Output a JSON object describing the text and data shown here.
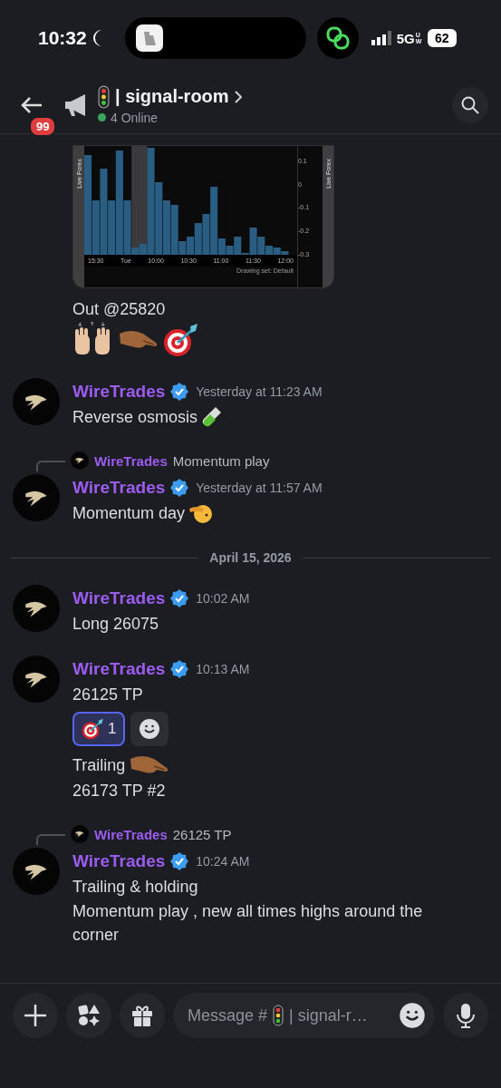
{
  "status_bar": {
    "time": "10:32",
    "network": "5G",
    "network_sub": "UW",
    "battery": "62"
  },
  "header": {
    "unread_badge": "99",
    "channel": "| signal-room",
    "online": "4 Online"
  },
  "attachment": {
    "side_labels": [
      "Live Forex",
      "Live Forex"
    ],
    "y_labels": [
      "0.1",
      "0",
      "-0.1",
      "-0.2",
      "-0.3"
    ],
    "x_labels": [
      "15:30",
      "Tue",
      "10:00",
      "10:30",
      "11:00",
      "11:30",
      "12:00"
    ],
    "footer": "Drawing set: Default"
  },
  "messages": [
    {
      "kind": "continued",
      "lines": [
        {
          "text": "Out @25820"
        },
        {
          "emoji": [
            {
              "kind": "hands"
            },
            {
              "kind": "reach"
            },
            {
              "kind": "target"
            }
          ]
        }
      ]
    },
    {
      "kind": "full",
      "author": "WireTrades",
      "verified": true,
      "time": "Yesterday at 11:23 AM",
      "lines": [
        {
          "text": "Reverse osmosis",
          "emoji": [
            {
              "kind": "tube"
            }
          ]
        }
      ]
    },
    {
      "kind": "full",
      "reply": {
        "author": "WireTrades",
        "text": "Momentum play"
      },
      "author": "WireTrades",
      "verified": true,
      "time": "Yesterday at 11:57 AM",
      "lines": [
        {
          "text": "Momentum day",
          "emoji": [
            {
              "kind": "salute"
            }
          ]
        }
      ]
    },
    {
      "kind": "divider",
      "text": "April 15, 2026"
    },
    {
      "kind": "full",
      "author": "WireTrades",
      "verified": true,
      "time": "10:02 AM",
      "lines": [
        {
          "text": "Long 26075"
        }
      ]
    },
    {
      "kind": "full",
      "author": "WireTrades",
      "verified": true,
      "time": "10:13 AM",
      "lines": [
        {
          "text": "26125 TP"
        }
      ],
      "reactions": [
        {
          "kind": "target",
          "count": "1",
          "selected": true
        }
      ],
      "more_lines": [
        {
          "text": "Trailing",
          "emoji": [
            {
              "kind": "reach"
            }
          ]
        },
        {
          "text": "26173 TP #2"
        }
      ]
    },
    {
      "kind": "full",
      "reply": {
        "author": "WireTrades",
        "text": "26125 TP"
      },
      "author": "WireTrades",
      "verified": true,
      "time": "10:24 AM",
      "lines": [
        {
          "text": "Trailing & holding"
        },
        {
          "text": "Momentum play , new all times highs around the corner"
        }
      ]
    }
  ],
  "composer": {
    "hint_start": "Message #",
    "hint_end": "| signal-r…"
  }
}
